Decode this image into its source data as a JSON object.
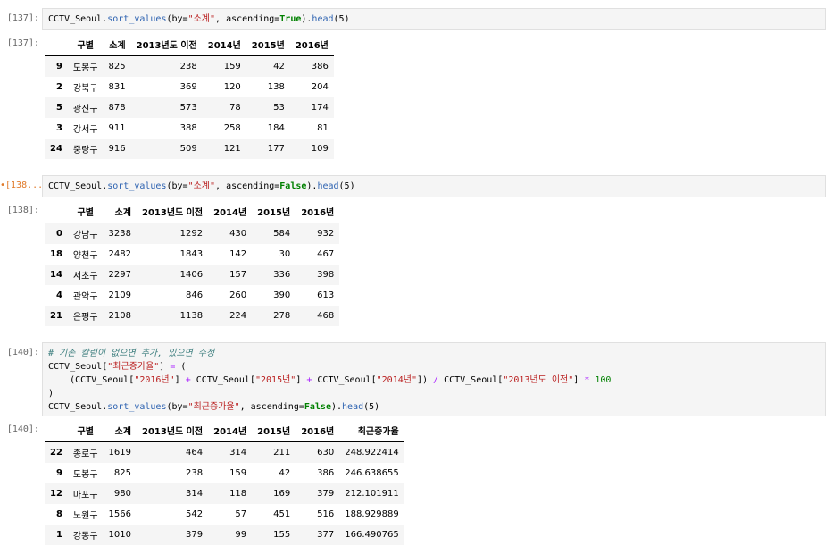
{
  "cells": [
    {
      "in_prompt": "[137]:",
      "out_prompt": "[137]:",
      "code": "CCTV_Seoul.sort_values(by=\"소계\", ascending=True).head(5)",
      "columns": [
        "구별",
        "소계",
        "2013년도 이전",
        "2014년",
        "2015년",
        "2016년"
      ],
      "rows": [
        {
          "idx": "9",
          "name": "도봉구",
          "v": [
            "825",
            "238",
            "159",
            "42",
            "386"
          ]
        },
        {
          "idx": "2",
          "name": "강북구",
          "v": [
            "831",
            "369",
            "120",
            "138",
            "204"
          ]
        },
        {
          "idx": "5",
          "name": "광진구",
          "v": [
            "878",
            "573",
            "78",
            "53",
            "174"
          ]
        },
        {
          "idx": "3",
          "name": "강서구",
          "v": [
            "911",
            "388",
            "258",
            "184",
            "81"
          ]
        },
        {
          "idx": "24",
          "name": "중랑구",
          "v": [
            "916",
            "509",
            "121",
            "177",
            "109"
          ]
        }
      ]
    },
    {
      "in_prompt": "•[138...",
      "out_prompt": "[138]:",
      "code": "CCTV_Seoul.sort_values(by=\"소계\", ascending=False).head(5)",
      "columns": [
        "구별",
        "소계",
        "2013년도 이전",
        "2014년",
        "2015년",
        "2016년"
      ],
      "rows": [
        {
          "idx": "0",
          "name": "강남구",
          "v": [
            "3238",
            "1292",
            "430",
            "584",
            "932"
          ]
        },
        {
          "idx": "18",
          "name": "양천구",
          "v": [
            "2482",
            "1843",
            "142",
            "30",
            "467"
          ]
        },
        {
          "idx": "14",
          "name": "서초구",
          "v": [
            "2297",
            "1406",
            "157",
            "336",
            "398"
          ]
        },
        {
          "idx": "4",
          "name": "관악구",
          "v": [
            "2109",
            "846",
            "260",
            "390",
            "613"
          ]
        },
        {
          "idx": "21",
          "name": "은평구",
          "v": [
            "2108",
            "1138",
            "224",
            "278",
            "468"
          ]
        }
      ]
    },
    {
      "in_prompt": "[140]:",
      "out_prompt": "[140]:",
      "code_lines": [
        "# 기존 칼럼이 없으면 추가, 있으면 수정",
        "CCTV_Seoul[\"최근증가율\"] = (",
        "    (CCTV_Seoul[\"2016년\"] + CCTV_Seoul[\"2015년\"] + CCTV_Seoul[\"2014년\"]) / CCTV_Seoul[\"2013년도 이전\"] * 100",
        ")",
        "CCTV_Seoul.sort_values(by=\"최근증가율\", ascending=False).head(5)"
      ],
      "columns": [
        "구별",
        "소계",
        "2013년도 이전",
        "2014년",
        "2015년",
        "2016년",
        "최근증가율"
      ],
      "rows": [
        {
          "idx": "22",
          "name": "종로구",
          "v": [
            "1619",
            "464",
            "314",
            "211",
            "630",
            "248.922414"
          ]
        },
        {
          "idx": "9",
          "name": "도봉구",
          "v": [
            "825",
            "238",
            "159",
            "42",
            "386",
            "246.638655"
          ]
        },
        {
          "idx": "12",
          "name": "마포구",
          "v": [
            "980",
            "314",
            "118",
            "169",
            "379",
            "212.101911"
          ]
        },
        {
          "idx": "8",
          "name": "노원구",
          "v": [
            "1566",
            "542",
            "57",
            "451",
            "516",
            "188.929889"
          ]
        },
        {
          "idx": "1",
          "name": "강동구",
          "v": [
            "1010",
            "379",
            "99",
            "155",
            "377",
            "166.490765"
          ]
        }
      ]
    }
  ],
  "colors": {
    "code_bg": "#f5f5f5",
    "running_prompt": "#e07a2a",
    "keyword": "#008000",
    "string": "#ba2121",
    "comment": "#408080"
  }
}
